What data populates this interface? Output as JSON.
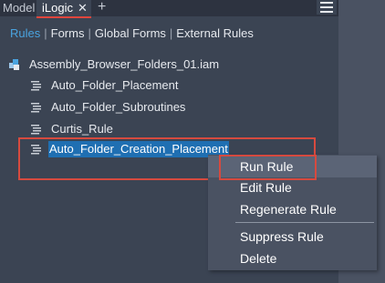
{
  "tabs": {
    "model_label": "Model",
    "ilogic_label": "iLogic",
    "close_glyph": "✕",
    "add_glyph": "+"
  },
  "subtabs": {
    "items": [
      "Rules",
      "Forms",
      "Global Forms",
      "External Rules"
    ],
    "separator": "|"
  },
  "tree": {
    "root": "Assembly_Browser_Folders_01.iam",
    "rules": [
      "Auto_Folder_Placement",
      "Auto_Folder_Subroutines",
      "Curtis_Rule",
      "Auto_Folder_Creation_Placement"
    ]
  },
  "context_menu": {
    "items": [
      "Run Rule",
      "Edit Rule",
      "Regenerate Rule",
      "Suppress Rule",
      "Delete"
    ]
  },
  "colors": {
    "accent": "#4aa3df",
    "selection": "#1f6fb2",
    "highlight": "#d64a3f",
    "panel": "#3b4453"
  },
  "icons": {
    "assembly": "assembly-icon",
    "rule": "rule-icon",
    "menu": "hamburger-menu-icon"
  }
}
